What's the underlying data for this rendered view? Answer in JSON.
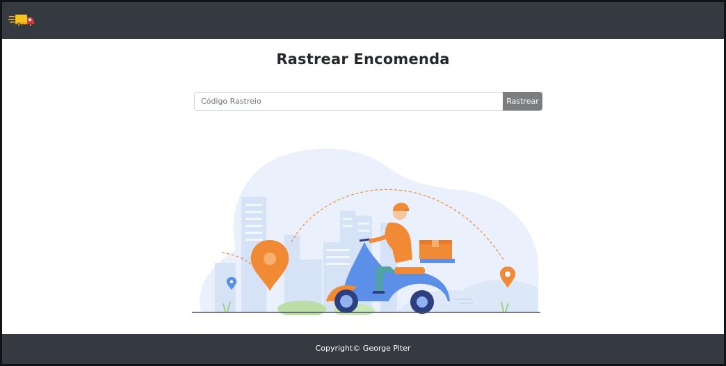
{
  "navbar": {
    "brand_icon": "delivery-truck-icon",
    "colors": {
      "background": "#343a40"
    }
  },
  "main": {
    "title": "Rastrear Encomenda",
    "search": {
      "placeholder": "Código Rastreio",
      "value": "",
      "button_label": "Rastrear"
    },
    "illustration": "delivery-scooter-illustration"
  },
  "footer": {
    "text": "Copyright© George Piter"
  },
  "colors": {
    "accent": "#f08a34",
    "button": "#7b7d80",
    "scooter": "#5b8fe8"
  }
}
